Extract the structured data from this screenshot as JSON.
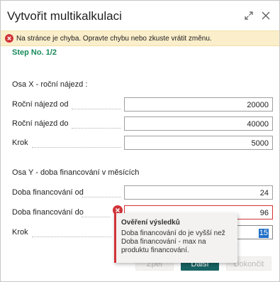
{
  "dialog": {
    "title": "Vytvořit multikalkulaci",
    "error_message": "Na stránce je chyba. Opravte chybu nebo zkuste vrátit změnu.",
    "step": "Step No. 1/2"
  },
  "section_x": {
    "title": "Osa X - roční nájezd :",
    "rows": [
      {
        "label": "Roční nájezd od",
        "value": "20000"
      },
      {
        "label": "Roční nájezd do",
        "value": "40000"
      },
      {
        "label": "Krok",
        "value": "5000"
      }
    ]
  },
  "section_y": {
    "title": "Osa Y - doba financování v měsících",
    "rows": [
      {
        "label": "Doba financování od",
        "value": "24"
      },
      {
        "label": "Doba financování do",
        "value": "96"
      },
      {
        "label": "Krok",
        "value": "15"
      }
    ]
  },
  "tooltip": {
    "title": "Ověření výsledků",
    "body": "Doba financování do je vyšší než Doba financování - max na produktu financování."
  },
  "buttons": {
    "back": "Zpět",
    "next": "Další",
    "finish": "Dokončit"
  },
  "colors": {
    "error_bar": "#fbeecb",
    "error_red": "#d13438",
    "step_green": "#188a5a",
    "primary_button": "#186262"
  }
}
